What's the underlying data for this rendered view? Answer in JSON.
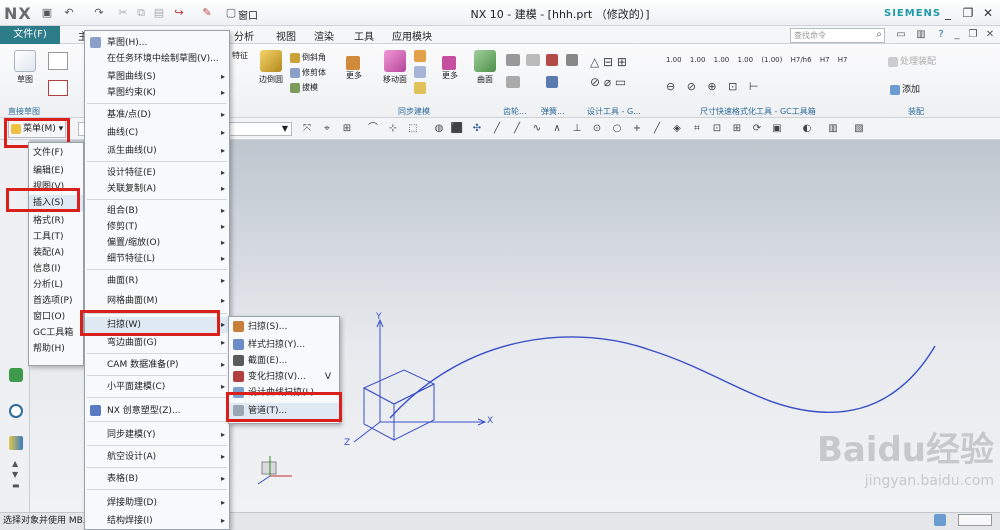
{
  "app": {
    "logo": "NX",
    "title": "NX 10 - 建模 - [hhh.prt （修改的）]",
    "brand": "SIEMENS",
    "window_label": "窗口"
  },
  "menubar": {
    "file": "文件(F)",
    "tab_home": "主",
    "tabs": [
      "分析",
      "视图",
      "渲染",
      "工具",
      "应用模块"
    ],
    "search_placeholder": "查找命令"
  },
  "ribbon": {
    "sketch_label": "草图",
    "direct_sketch_group": "直接草图",
    "feature_items": [
      "倒斜角",
      "修剪体",
      "拔模"
    ],
    "feature_top": "特征",
    "edge_round": "边倒圆",
    "more": "更多",
    "move_face": "移动面",
    "more2": "更多",
    "surface": "曲面",
    "sync_group": "同步建模",
    "gear_group": "齿轮...",
    "spring_group": "弹簧...",
    "design_tools_group": "设计工具 - G...",
    "gc_group": "尺寸快速格式化工具 - GC工具箱",
    "gc_labels": [
      "1.00",
      "1.00",
      "1.00",
      "1.00",
      "(1.00)",
      "H7/h6",
      "H7",
      "H7"
    ],
    "assembly_group": "装配",
    "add_label": "添加",
    "process_label": "处理装配"
  },
  "menu_button": "菜单(M)",
  "main_menu": [
    "文件(F)",
    "编辑(E)",
    "视图(V)",
    "插入(S)",
    "格式(R)",
    "工具(T)",
    "装配(A)",
    "信息(I)",
    "分析(L)",
    "首选项(P)",
    "窗口(O)",
    "GC工具箱",
    "帮助(H)"
  ],
  "insert_menu": [
    {
      "label": "草图(H)...",
      "arrow": false
    },
    {
      "label": "在任务环境中绘制草图(V)...",
      "arrow": false
    },
    {
      "label": "草图曲线(S)",
      "arrow": true
    },
    {
      "label": "草图约束(K)",
      "arrow": true
    },
    {
      "label": "基准/点(D)",
      "arrow": true
    },
    {
      "label": "曲线(C)",
      "arrow": true
    },
    {
      "label": "派生曲线(U)",
      "arrow": true
    },
    {
      "label": "设计特征(E)",
      "arrow": true
    },
    {
      "label": "关联复制(A)",
      "arrow": true
    },
    {
      "label": "组合(B)",
      "arrow": true
    },
    {
      "label": "修剪(T)",
      "arrow": true
    },
    {
      "label": "偏置/缩放(O)",
      "arrow": true
    },
    {
      "label": "细节特征(L)",
      "arrow": true
    },
    {
      "label": "曲面(R)",
      "arrow": true
    },
    {
      "label": "网格曲面(M)",
      "arrow": true
    },
    {
      "label": "扫掠(W)",
      "arrow": true
    },
    {
      "label": "弯边曲面(G)",
      "arrow": true
    },
    {
      "label": "CAM 数据准备(P)",
      "arrow": true
    },
    {
      "label": "小平面建模(C)",
      "arrow": true
    },
    {
      "label": "NX 创意塑型(Z)...",
      "arrow": false
    },
    {
      "label": "同步建模(Y)",
      "arrow": true
    },
    {
      "label": "航空设计(A)",
      "arrow": true
    },
    {
      "label": "表格(B)",
      "arrow": true
    },
    {
      "label": "焊接助理(D)",
      "arrow": true
    },
    {
      "label": "结构焊接(I)",
      "arrow": true
    }
  ],
  "sweep_menu": [
    "扫掠(S)...",
    "样式扫掠(Y)...",
    "截面(E)...",
    "变化扫掠(V)...",
    "设计曲线扫掠(L)...",
    "管道(T)..."
  ],
  "sweep_menu_shortcut": "V",
  "axes": {
    "x": "X",
    "y": "Y",
    "z": "Z"
  },
  "status": {
    "text": "选择对象并使用 MB3"
  },
  "watermark": {
    "brand": "Baidu经验",
    "url": "jingyan.baidu.com"
  },
  "colors": {
    "file_tab": "#2d7c8a",
    "highlight_box": "#d9201c",
    "curve": "#3a4fc8",
    "siemens": "#1f9aa8"
  }
}
